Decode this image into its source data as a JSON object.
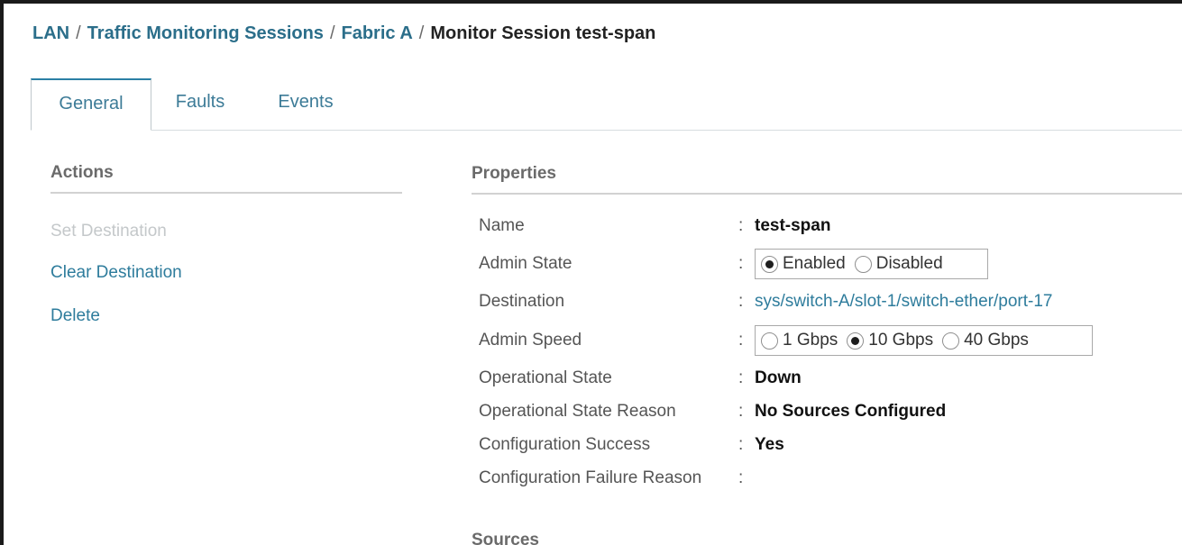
{
  "breadcrumb": {
    "items": [
      "LAN",
      "Traffic Monitoring Sessions",
      "Fabric A"
    ],
    "separator": "/",
    "current": "Monitor Session test-span"
  },
  "tabs": [
    {
      "label": "General",
      "active": true
    },
    {
      "label": "Faults",
      "active": false
    },
    {
      "label": "Events",
      "active": false
    }
  ],
  "actions": {
    "title": "Actions",
    "items": [
      {
        "label": "Set Destination",
        "enabled": false
      },
      {
        "label": "Clear Destination",
        "enabled": true
      },
      {
        "label": "Delete",
        "enabled": true
      }
    ]
  },
  "properties": {
    "title": "Properties",
    "colon": ":",
    "name": {
      "label": "Name",
      "value": "test-span"
    },
    "admin_state": {
      "label": "Admin State",
      "options": [
        {
          "label": "Enabled",
          "checked": true
        },
        {
          "label": "Disabled",
          "checked": false
        }
      ]
    },
    "destination": {
      "label": "Destination",
      "value": "sys/switch-A/slot-1/switch-ether/port-17"
    },
    "admin_speed": {
      "label": "Admin Speed",
      "options": [
        {
          "label": "1 Gbps",
          "checked": false
        },
        {
          "label": "10 Gbps",
          "checked": true
        },
        {
          "label": "40 Gbps",
          "checked": false
        }
      ]
    },
    "operational_state": {
      "label": "Operational State",
      "value": "Down"
    },
    "operational_state_reason": {
      "label": "Operational State Reason",
      "value": "No Sources Configured"
    },
    "configuration_success": {
      "label": "Configuration Success",
      "value": "Yes"
    },
    "configuration_failure_reason": {
      "label": "Configuration Failure Reason",
      "value": ""
    }
  },
  "sources": {
    "title": "Sources"
  },
  "colors": {
    "link": "#2e7c9c",
    "breadcrumb_link": "#2b6e8a",
    "disabled": "#c4c8ca",
    "active_tab_border": "#2b7fa5"
  }
}
